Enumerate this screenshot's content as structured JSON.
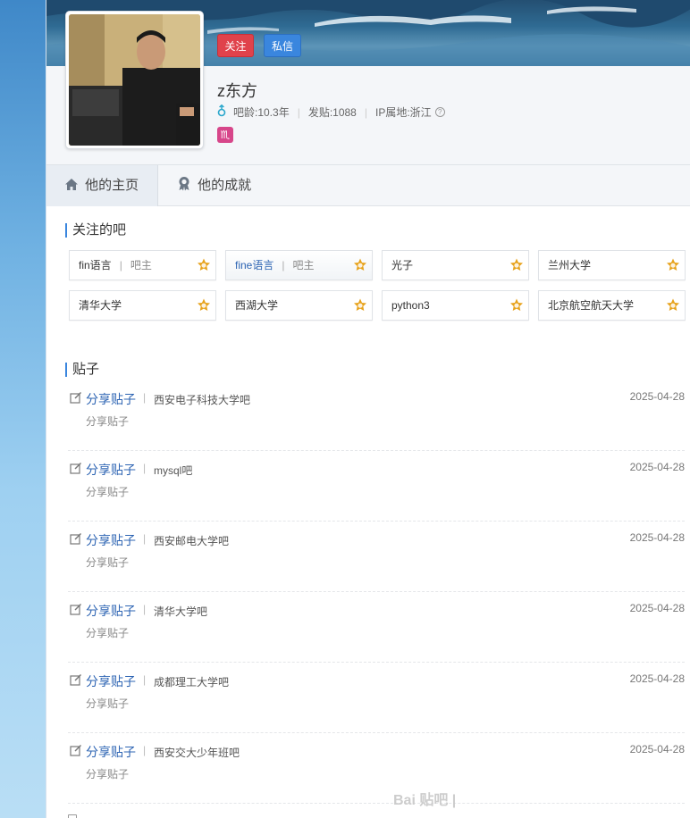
{
  "header": {
    "follow_label": "关注",
    "message_label": "私信",
    "username": "z东方",
    "age": "吧龄:10.3年",
    "posts": "发贴:1088",
    "ip": "IP属地:浙江",
    "help_icon": "?",
    "zodiac_glyph": "♏"
  },
  "tabs": [
    {
      "label": "他的主页",
      "icon": "home-icon"
    },
    {
      "label": "他的成就",
      "icon": "award-icon"
    }
  ],
  "forums_title": "关注的吧",
  "forums": [
    {
      "name": "fin语言",
      "role": "吧主",
      "divider": "|"
    },
    {
      "name": "fine语言",
      "role": "吧主",
      "divider": "|"
    },
    {
      "name": "光子"
    },
    {
      "name": "兰州大学"
    },
    {
      "name": "清华大学"
    },
    {
      "name": "西湖大学"
    },
    {
      "name": "python3"
    },
    {
      "name": "北京航空航天大学"
    }
  ],
  "posts_title": "贴子",
  "posts": [
    {
      "kind": "分享贴子",
      "forum": "西安电子科技大学吧",
      "sub": "分享贴子",
      "date": "2025-04-28"
    },
    {
      "kind": "分享贴子",
      "forum": "mysql吧",
      "sub": "分享贴子",
      "date": "2025-04-28"
    },
    {
      "kind": "分享贴子",
      "forum": "西安邮电大学吧",
      "sub": "分享贴子",
      "date": "2025-04-28"
    },
    {
      "kind": "分享贴子",
      "forum": "清华大学吧",
      "sub": "分享贴子",
      "date": "2025-04-28"
    },
    {
      "kind": "分享贴子",
      "forum": "成都理工大学吧",
      "sub": "分享贴子",
      "date": "2025-04-28"
    },
    {
      "kind": "分享贴子",
      "forum": "西安交大少年班吧",
      "sub": "分享贴子",
      "date": "2025-04-28"
    }
  ],
  "watermark": "Bai 贴吧 |",
  "colors": {
    "accent": "#2d64b3",
    "follow": "#e0424b",
    "message": "#3a86de",
    "level_badge": "#e7a21b"
  }
}
